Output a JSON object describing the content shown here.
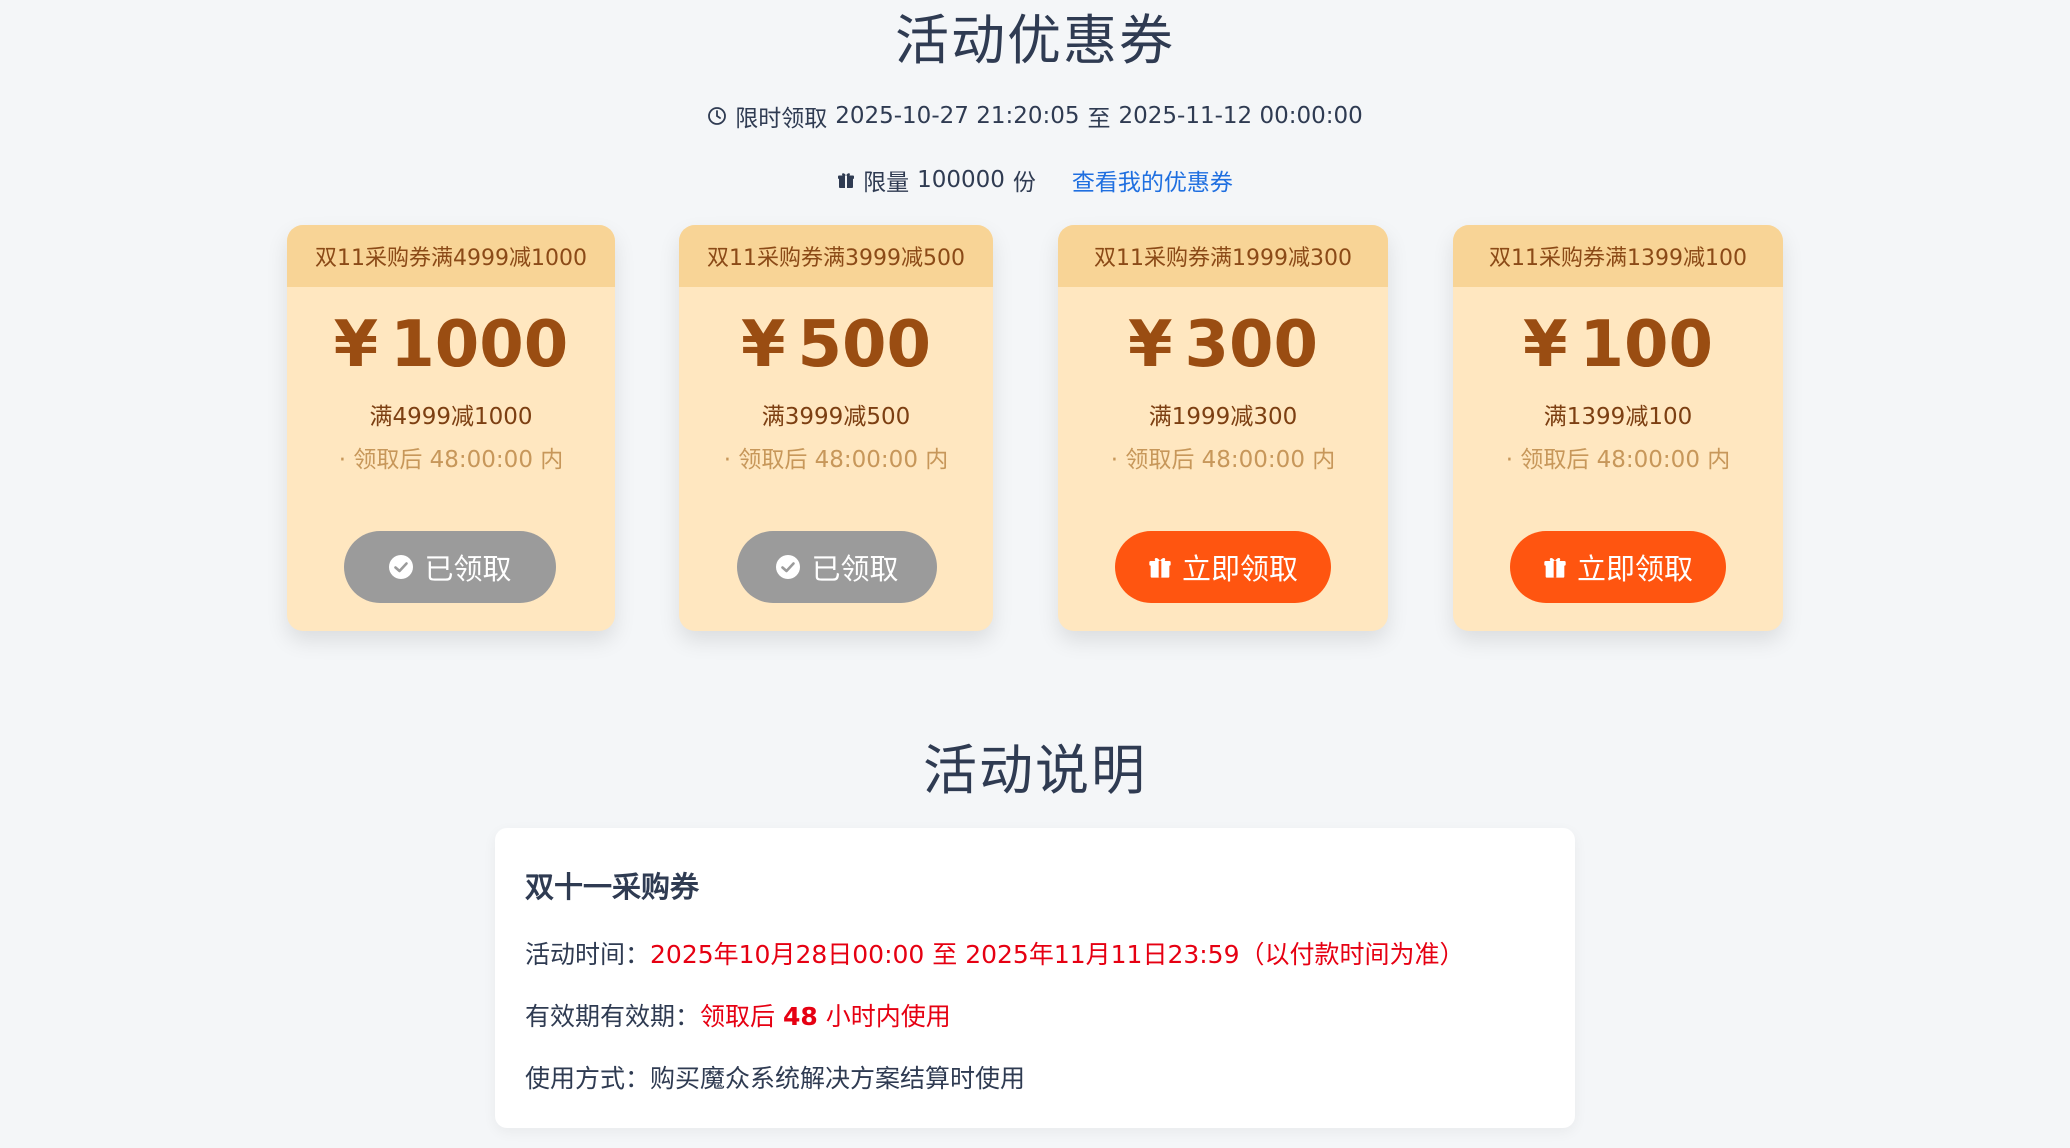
{
  "header": {
    "title": "活动优惠券",
    "time_prefix": "限时领取",
    "time_start": "2025-10-27 21:20:05",
    "time_sep": "至",
    "time_end": "2025-11-12 00:00:00",
    "limit_prefix": "限量",
    "limit_count": "100000",
    "limit_unit": "份",
    "my_coupons_link": "查看我的优惠券"
  },
  "coupons": [
    {
      "title": "双11采购券满4999减1000",
      "amount": "1000",
      "condition": "满4999减1000",
      "validity": "· 领取后 48:00:00 内",
      "button": "已领取",
      "status": "claimed"
    },
    {
      "title": "双11采购券满3999减500",
      "amount": "500",
      "condition": "满3999减500",
      "validity": "· 领取后 48:00:00 内",
      "button": "已领取",
      "status": "claimed"
    },
    {
      "title": "双11采购券满1999减300",
      "amount": "300",
      "condition": "满1999减300",
      "validity": "· 领取后 48:00:00 内",
      "button": "立即领取",
      "status": "available"
    },
    {
      "title": "双11采购券满1399减100",
      "amount": "100",
      "condition": "满1399减100",
      "validity": "· 领取后 48:00:00 内",
      "button": "立即领取",
      "status": "available"
    }
  ],
  "currency_symbol": "¥",
  "details": {
    "section_title": "活动说明",
    "card_title": "双十一采购券",
    "time_label": "活动时间：",
    "time_value": "2025年10月28日00:00 至 2025年11月11日23:59（以付款时间为准）",
    "validity_label": "有效期有效期：",
    "validity_prefix": "领取后 ",
    "validity_hours": "48",
    "validity_suffix": " 小时内使用",
    "usage_label": "使用方式：",
    "usage_value": "购买魔众系统解决方案结算时使用"
  },
  "colors": {
    "page_bg": "#f4f6f8",
    "coupon_bg": "#ffe7c0",
    "coupon_head_bg": "#f8d496",
    "amount": "#9a4d12",
    "claimed_button": "#9b9b9b",
    "claim_button": "#ff5510",
    "link": "#1f6fe0",
    "highlight": "#e60012"
  },
  "icons": {
    "time": "clock-icon",
    "limit": "gift-icon",
    "claimed": "check-circle-icon",
    "claim": "gift-icon"
  }
}
